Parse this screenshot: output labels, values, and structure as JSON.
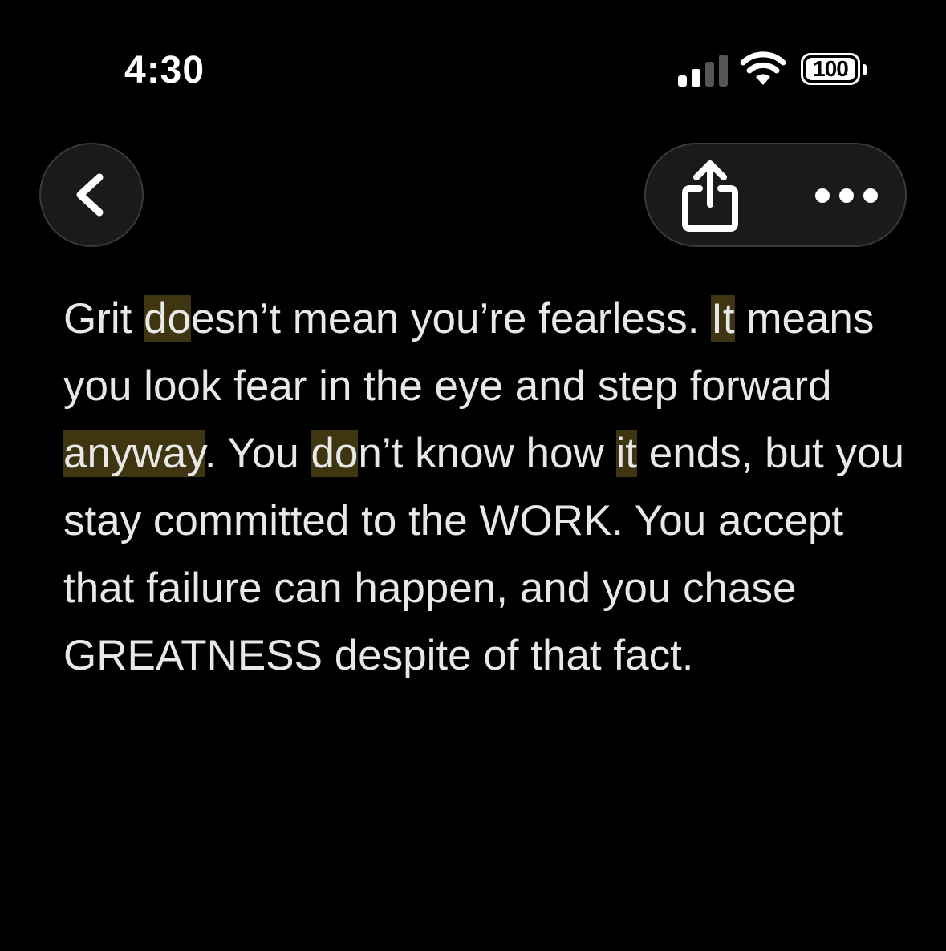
{
  "status_bar": {
    "time": "4:30",
    "battery": "100",
    "signal_icon": "cellular-signal-icon",
    "wifi_icon": "wifi-icon"
  },
  "toolbar": {
    "back_icon": "chevron-left-icon",
    "share_icon": "share-icon",
    "more_icon": "ellipsis-icon"
  },
  "article": {
    "segments": [
      {
        "text": "Grit ",
        "highlight": false
      },
      {
        "text": "do",
        "highlight": true
      },
      {
        "text": "esn’t mean you’re fearless. ",
        "highlight": false
      },
      {
        "text": "It",
        "highlight": true
      },
      {
        "text": " means you look fear in the eye and step forward ",
        "highlight": false
      },
      {
        "text": "anyway",
        "highlight": true
      },
      {
        "text": ". You ",
        "highlight": false
      },
      {
        "text": "do",
        "highlight": true
      },
      {
        "text": "n’t know how ",
        "highlight": false
      },
      {
        "text": "it",
        "highlight": true
      },
      {
        "text": " ends, but you stay committed to the WORK. You accept that failure can happen, and you chase GREATNESS despite of that fact.",
        "highlight": false
      }
    ]
  },
  "colors": {
    "background": "#000000",
    "text": "#e8e8e8",
    "highlight": "#3f3511",
    "button_bg": "#1a1a1a"
  }
}
